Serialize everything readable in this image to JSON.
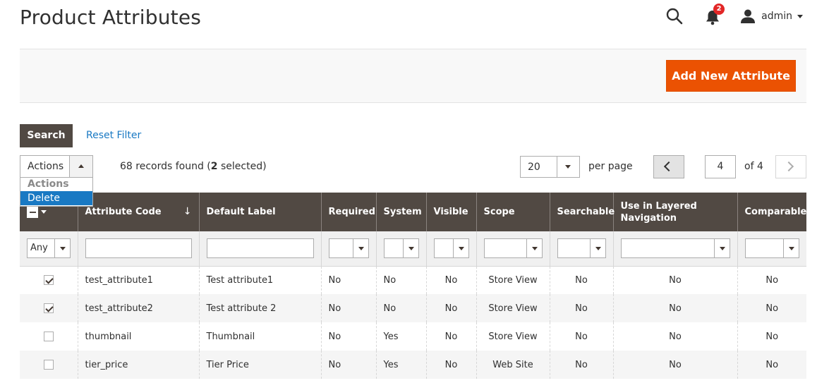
{
  "page": {
    "title": "Product Attributes"
  },
  "header": {
    "notification_count": "2",
    "user_name": "admin"
  },
  "toolbar": {
    "add_button_label": "Add New Attribute"
  },
  "filters": {
    "search_label": "Search",
    "reset_label": "Reset Filter"
  },
  "mass_actions": {
    "selected_value": "Actions",
    "options": [
      "Actions",
      "Delete"
    ]
  },
  "records": {
    "count_text": "68 records found (",
    "selected_count": "2",
    "selected_suffix": " selected)"
  },
  "pager": {
    "per_page_value": "20",
    "per_page_label": "per page",
    "current_page": "4",
    "total_label": "of 4"
  },
  "grid": {
    "columns": [
      "Attribute Code",
      "Default Label",
      "Required",
      "System",
      "Visible",
      "Scope",
      "Searchable",
      "Use in Layered Navigation",
      "Comparable"
    ],
    "sort_indicator": "↓",
    "any_filter_value": "Any",
    "rows": [
      {
        "checked": true,
        "code": "test_attribute1",
        "label": "Test attribute1",
        "required": "No",
        "system": "No",
        "visible": "No",
        "scope": "Store View",
        "searchable": "No",
        "layered": "No",
        "comparable": "No"
      },
      {
        "checked": true,
        "code": "test_attribute2",
        "label": "Test attribute 2",
        "required": "No",
        "system": "No",
        "visible": "No",
        "scope": "Store View",
        "searchable": "No",
        "layered": "No",
        "comparable": "No"
      },
      {
        "checked": false,
        "code": "thumbnail",
        "label": "Thumbnail",
        "required": "No",
        "system": "Yes",
        "visible": "No",
        "scope": "Store View",
        "searchable": "No",
        "layered": "No",
        "comparable": "No"
      },
      {
        "checked": false,
        "code": "tier_price",
        "label": "Tier Price",
        "required": "No",
        "system": "Yes",
        "visible": "No",
        "scope": "Web Site",
        "searchable": "No",
        "layered": "No",
        "comparable": "No"
      }
    ]
  },
  "colors": {
    "accent": "#eb5202",
    "header_bg": "#514943",
    "link": "#1979c3",
    "badge": "#e22626"
  }
}
